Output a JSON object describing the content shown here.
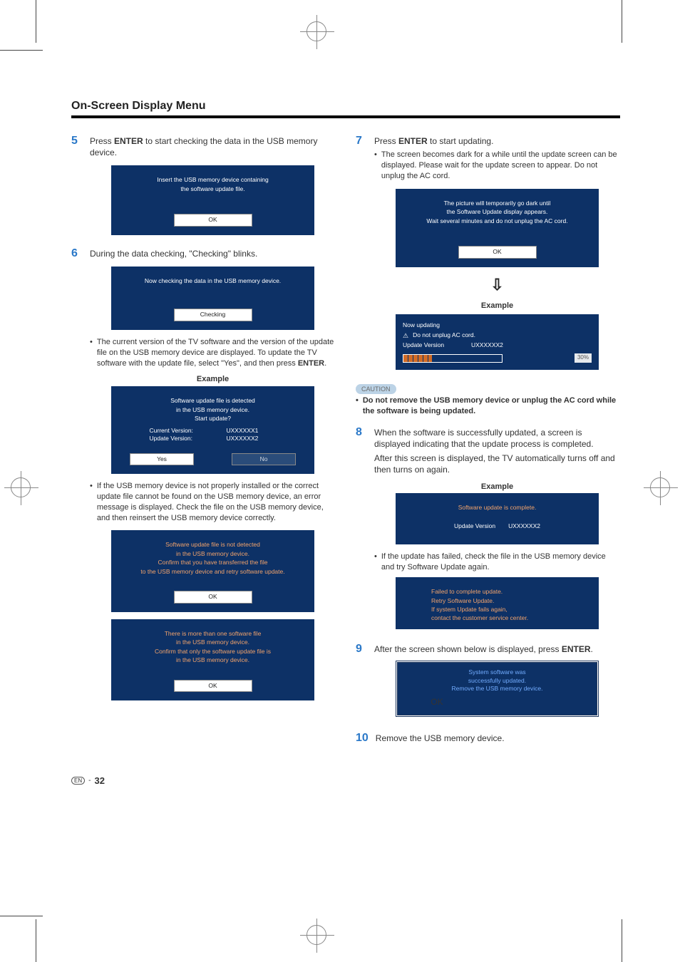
{
  "title": "On-Screen Display Menu",
  "left": {
    "step5": {
      "num": "5",
      "text_a": "Press ",
      "enter": "ENTER",
      "text_b": " to start checking the data in the USB memory device.",
      "screen": {
        "line1": "Insert the USB memory device containing",
        "line2": "the software update file.",
        "ok": "OK"
      }
    },
    "step6": {
      "num": "6",
      "text": "During the data checking, \"Checking\" blinks.",
      "screen": {
        "line": "Now checking the data in the USB memory device.",
        "status": "Checking"
      },
      "bullet": "The current version of the TV software and the version of the update file on the USB memory device are displayed. To update the TV software with the update file, select \"Yes\", and then press ",
      "bullet_enter": "ENTER",
      "bullet_period": ".",
      "example_label": "Example",
      "example_screen": {
        "line1": "Software update file is detected",
        "line2": "in the USB memory device.",
        "line3": "Start update?",
        "cur_label": "Current Version:",
        "cur_val": "UXXXXXX1",
        "upd_label": "Update Version:",
        "upd_val": "UXXXXXX2",
        "yes": "Yes",
        "no": "No"
      },
      "bullet2": "If the USB memory device is not properly installed or the correct update file cannot be found on the USB memory device, an error message is displayed. Check the file on the USB memory device, and then reinsert the USB memory device correctly.",
      "err1": {
        "l1": "Software update file is not detected",
        "l2": "in the USB memory device.",
        "l3": "Confirm that you have transferred the file",
        "l4": "to the USB memory device and retry software update.",
        "ok": "OK"
      },
      "err2": {
        "l1": "There is more than one software file",
        "l2": "in the USB memory device.",
        "l3": "Confirm that only the software update file is",
        "l4": "in the USB memory device.",
        "ok": "OK"
      }
    }
  },
  "right": {
    "step7": {
      "num": "7",
      "text_a": "Press ",
      "enter": "ENTER",
      "text_b": " to start updating.",
      "bullet": "The screen becomes dark for a while until the update screen can be displayed. Please wait for the update screen to appear. Do not unplug the AC cord.",
      "screen1": {
        "l1": "The picture will temporarily go dark until",
        "l2": "the Software Update display appears.",
        "l3": "Wait several minutes and do not unplug the AC cord.",
        "ok": "OK"
      },
      "example_label": "Example",
      "updating": {
        "l1": "Now updating",
        "l2": "Do not unplug AC cord.",
        "l3_label": "Update Version",
        "l3_val": "UXXXXXX2",
        "pct": "30%"
      }
    },
    "caution": {
      "pill": "CAUTION",
      "text": "Do not remove the USB memory device or unplug the AC cord while the software is being updated."
    },
    "step8": {
      "num": "8",
      "para1": "When the software is successfully updated, a screen is displayed indicating that the update process is completed.",
      "para2": "After this screen is displayed, the TV automatically turns off and then turns on again.",
      "example_label": "Example",
      "screen": {
        "l1": "Software update is complete.",
        "l2_label": "Update Version",
        "l2_val": "UXXXXXX2"
      },
      "bullet": "If the update has failed, check the file in the USB memory device and try Software Update again.",
      "err": {
        "l1": "Failed to complete update.",
        "l2": "Retry Software Update.",
        "l3": "If system Update fails again,",
        "l4": "contact the customer service center."
      }
    },
    "step9": {
      "num": "9",
      "text_a": "After the screen shown below is displayed, press ",
      "enter": "ENTER",
      "text_b": ".",
      "screen": {
        "l1": "System software was",
        "l2": "successfully updated.",
        "l3": "Remove the USB memory device.",
        "ok": "OK"
      }
    },
    "step10": {
      "num": "10",
      "text": "Remove the USB memory device."
    }
  },
  "footer": {
    "lang": "EN",
    "page": "32"
  }
}
